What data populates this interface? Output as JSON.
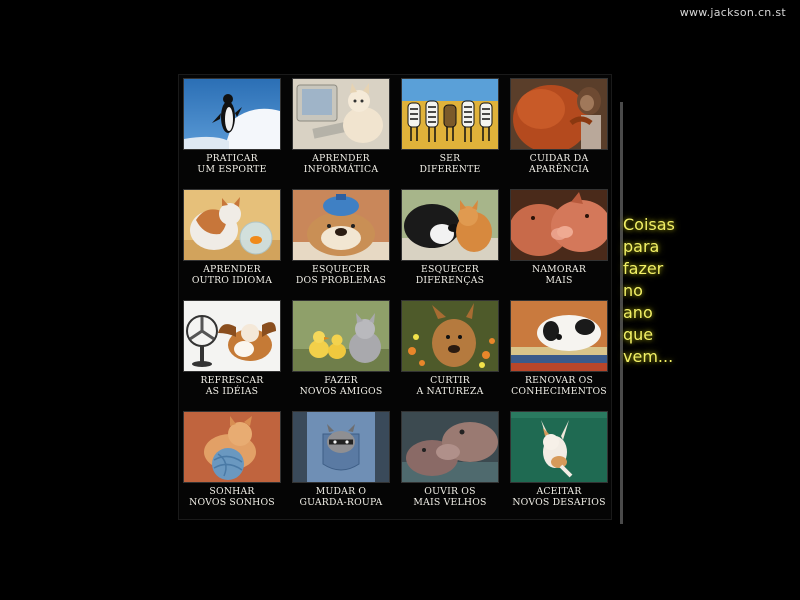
{
  "site": {
    "url": "www.jackson.cn.st"
  },
  "side_caption": [
    "Coisas",
    "para",
    "fazer",
    "no",
    "ano",
    "que",
    "vem..."
  ],
  "tiles": [
    {
      "id": "penguin",
      "icon": "penguin-photo",
      "caption": [
        "PRATICAR",
        "UM ESPORTE"
      ]
    },
    {
      "id": "computer-cat",
      "icon": "cat-computer-photo",
      "caption": [
        "APRENDER",
        "INFORMÁTICA"
      ]
    },
    {
      "id": "zebras",
      "icon": "zebras-photo",
      "caption": [
        "SER",
        "DIFERENTE"
      ]
    },
    {
      "id": "orangutan",
      "icon": "orangutan-photo",
      "caption": [
        "CUIDAR DA",
        "APARÊNCIA"
      ]
    },
    {
      "id": "cat-fish",
      "icon": "cat-fishbowl-photo",
      "caption": [
        "APRENDER",
        "OUTRO IDIOMA"
      ]
    },
    {
      "id": "bulldog",
      "icon": "bulldog-icepack-photo",
      "caption": [
        "ESQUECER",
        "DOS PROBLEMAS"
      ]
    },
    {
      "id": "dog-cat",
      "icon": "dog-and-cat-photo",
      "caption": [
        "ESQUECER",
        "DIFERENÇAS"
      ]
    },
    {
      "id": "pigs",
      "icon": "kissing-pigs-photo",
      "caption": [
        "NAMORAR",
        "MAIS"
      ]
    },
    {
      "id": "fan-dog",
      "icon": "dog-fan-photo",
      "caption": [
        "REFRESCAR",
        "AS IDÉIAS"
      ]
    },
    {
      "id": "ducks-cat",
      "icon": "ducklings-kitten-photo",
      "caption": [
        "FAZER",
        "NOVOS AMIGOS"
      ]
    },
    {
      "id": "deer",
      "icon": "fawn-flowers-photo",
      "caption": [
        "CURTIR",
        "A NATUREZA"
      ]
    },
    {
      "id": "puppy-books",
      "icon": "puppy-books-photo",
      "caption": [
        "RENOVAR OS",
        "CONHECIMENTOS"
      ]
    },
    {
      "id": "yarn-cat",
      "icon": "kitten-yarn-photo",
      "caption": [
        "SONHAR",
        "NOVOS SONHOS"
      ]
    },
    {
      "id": "raccoon",
      "icon": "raccoon-jeans-photo",
      "caption": [
        "MUDAR O",
        "GUARDA-ROUPA"
      ]
    },
    {
      "id": "hippos",
      "icon": "hippos-photo",
      "caption": [
        "OUVIR OS",
        "MAIS VELHOS"
      ]
    },
    {
      "id": "hanging-cat",
      "icon": "hanging-kitten-photo",
      "caption": [
        "ACEITAR",
        "NOVOS DESAFIOS"
      ]
    }
  ]
}
